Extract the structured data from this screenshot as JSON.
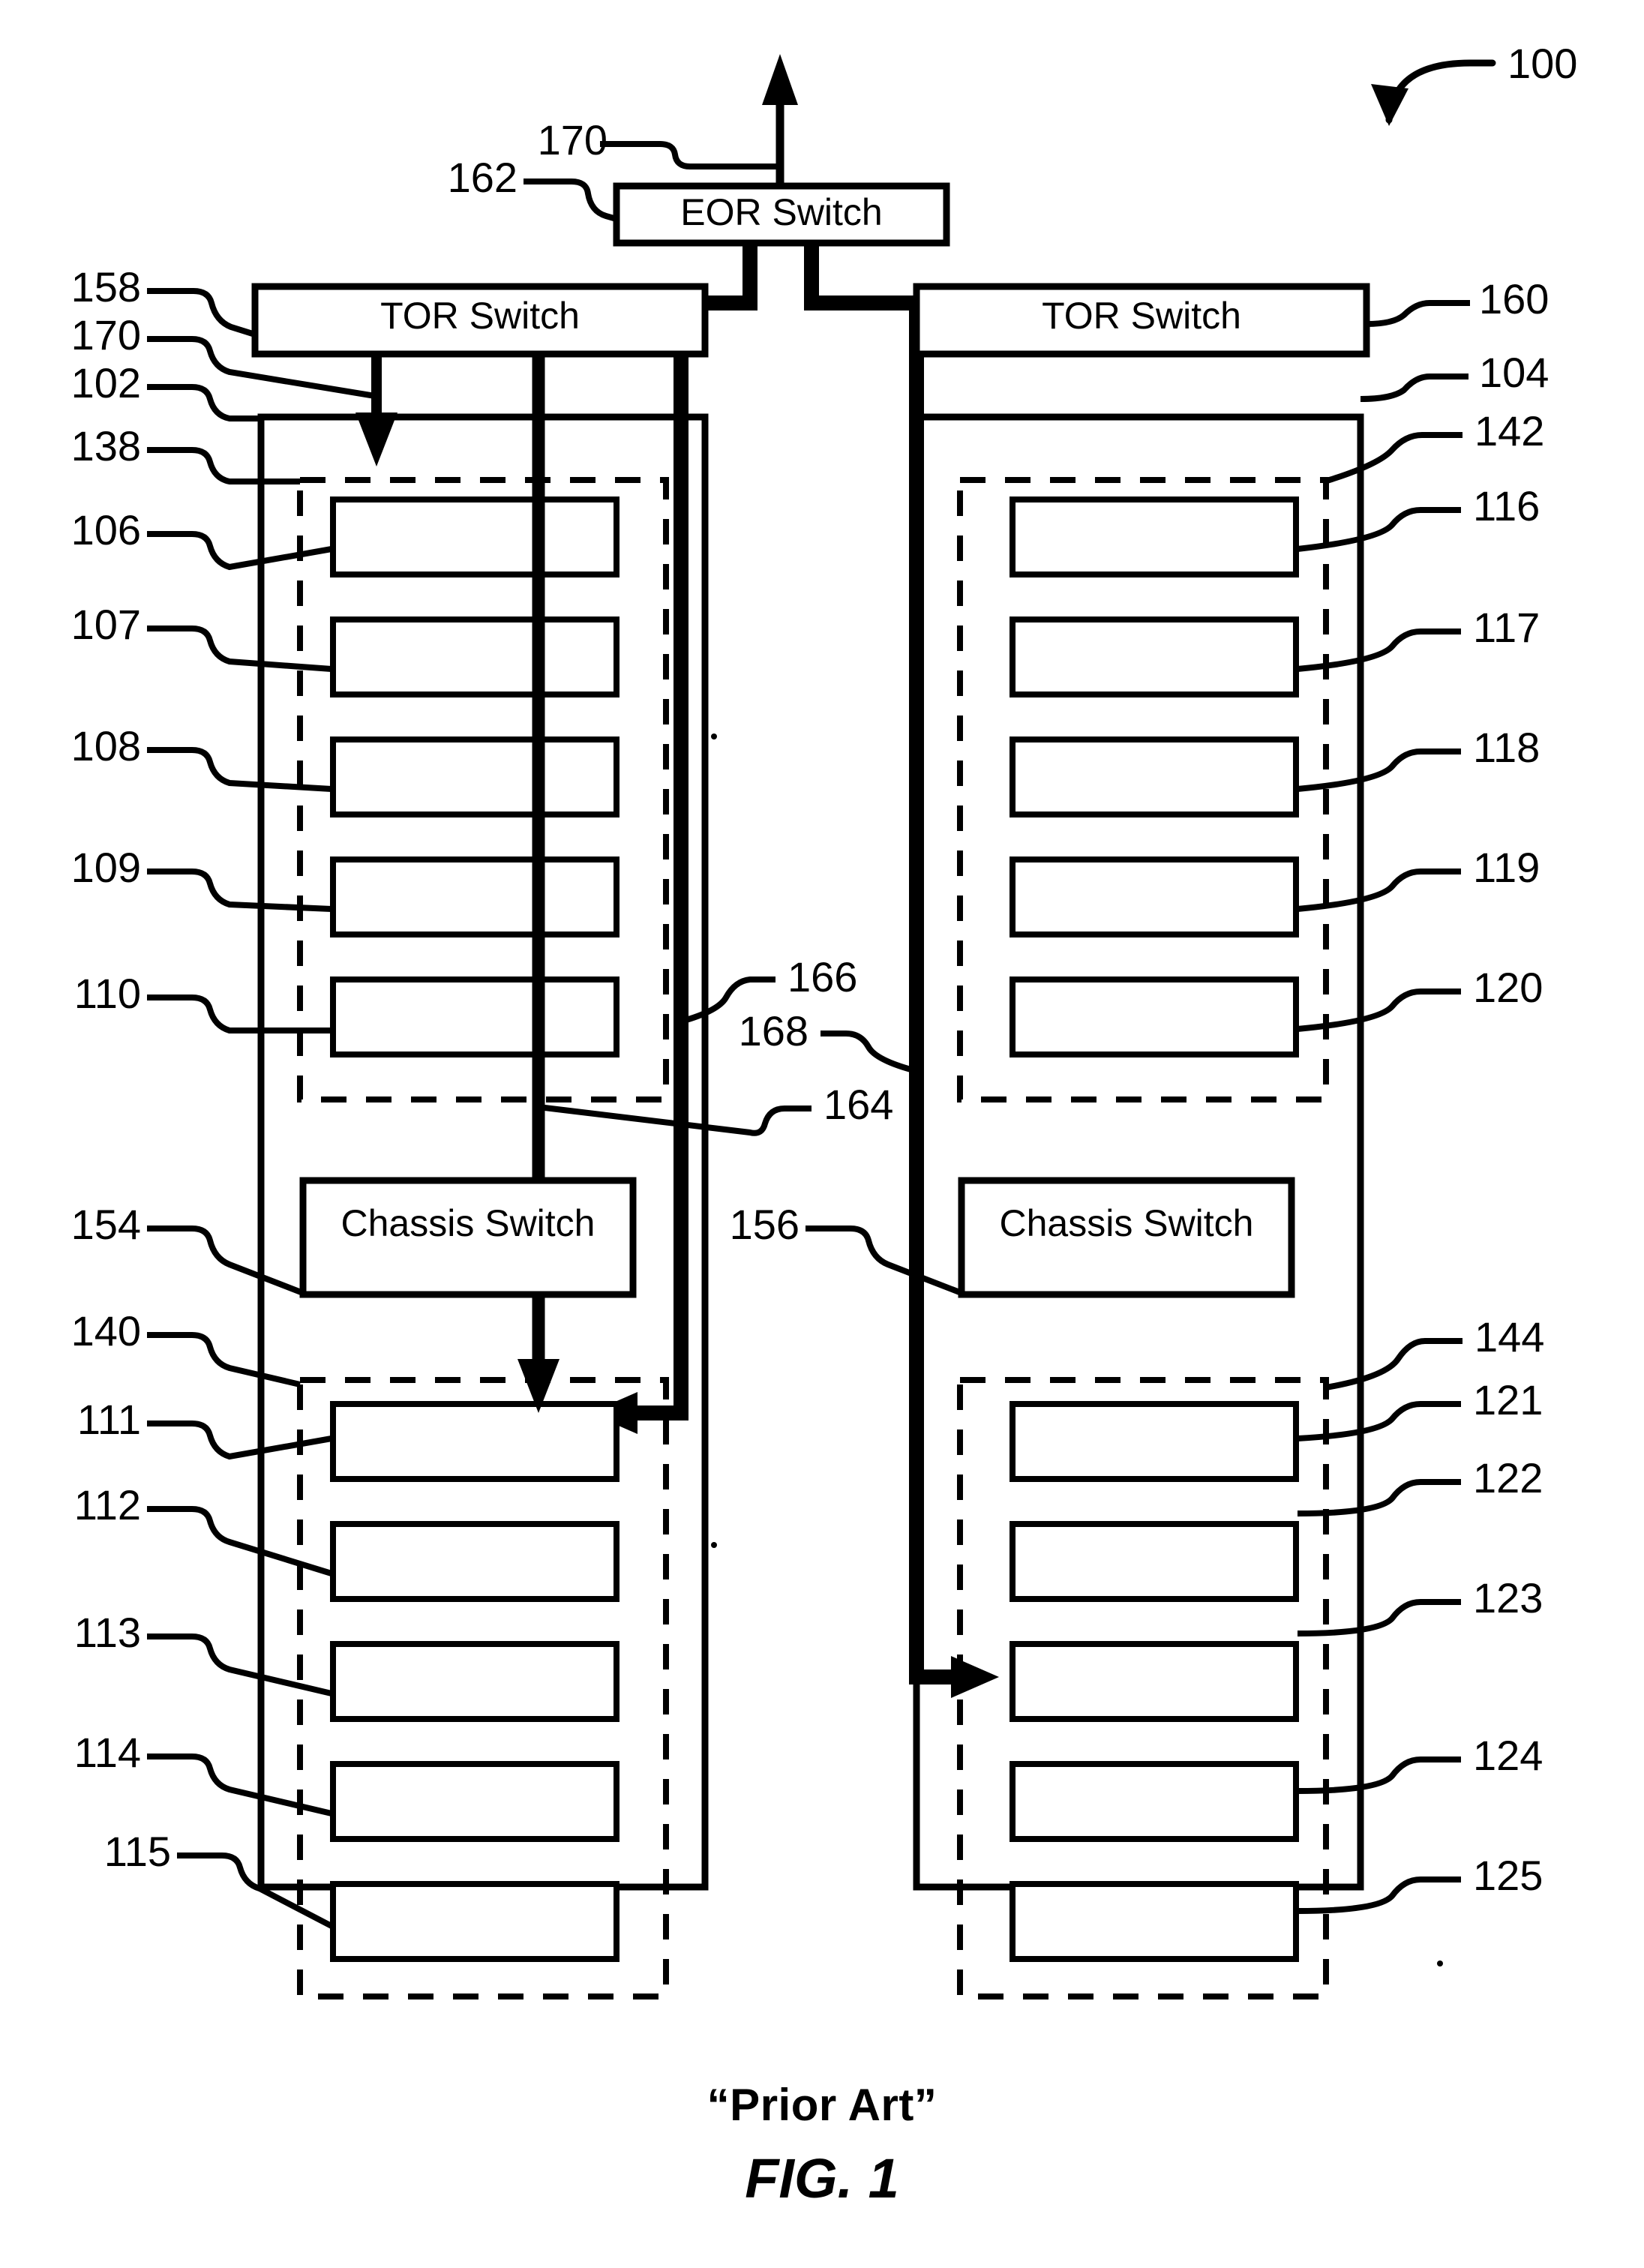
{
  "figure": {
    "system_ref": "100",
    "caption_prior_art": "“Prior Art”",
    "caption_figure": "FIG. 1"
  },
  "switches": {
    "eor": {
      "label": "EOR Switch",
      "ref": "162"
    },
    "tor_left": {
      "label": "TOR Switch",
      "ref": "158"
    },
    "tor_right": {
      "label": "TOR Switch",
      "ref": "160"
    },
    "chassis_left": {
      "label": "Chassis Switch",
      "ref": "154"
    },
    "chassis_right": {
      "label": "Chassis Switch",
      "ref": "156"
    }
  },
  "racks": {
    "left": {
      "ref": "102",
      "enclosure_top_ref": "138",
      "enclosure_bottom_ref": "140"
    },
    "right": {
      "ref": "104",
      "enclosure_top_ref": "142",
      "enclosure_bottom_ref": "144"
    }
  },
  "servers": {
    "left_top": [
      "106",
      "107",
      "108",
      "109",
      "110"
    ],
    "left_bottom": [
      "111",
      "112",
      "113",
      "114",
      "115"
    ],
    "right_top": [
      "116",
      "117",
      "118",
      "119",
      "120"
    ],
    "right_bottom": [
      "121",
      "122",
      "123",
      "124",
      "125"
    ]
  },
  "links": {
    "traffic_arrow_ref": "170",
    "eor_uplink_ref": "170",
    "tor_to_rack_arrow_ref": "170",
    "chassis_downlink_ref": "164",
    "left_trunk_ref": "166",
    "right_trunk_ref": "168"
  },
  "colors": {
    "line": "#000000",
    "background": "#ffffff"
  }
}
